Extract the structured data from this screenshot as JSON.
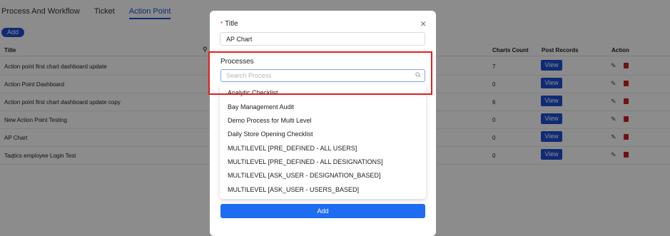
{
  "tabs": [
    "Process And Workflow",
    "Ticket",
    "Action Point"
  ],
  "toolbar": {
    "add_label": "Add"
  },
  "table": {
    "headers": {
      "title": "Title",
      "charts_count": "Charts Count",
      "post_records": "Post Records",
      "action": "Action"
    },
    "rows": [
      {
        "title": "Action point first chart dashboard update",
        "count": "7",
        "view": "View"
      },
      {
        "title": "Action Point Dashboard",
        "count": "0",
        "view": "View"
      },
      {
        "title": "Action point first chart dashboard update copy",
        "count": "6",
        "view": "View"
      },
      {
        "title": "New Action Point Testing",
        "count": "0",
        "view": "View"
      },
      {
        "title": "AP Chart",
        "count": "0",
        "view": "View"
      },
      {
        "title": "Taqtics employee Login Test",
        "count": "0",
        "view": "View"
      }
    ]
  },
  "modal": {
    "close": "×",
    "title_label": "Title",
    "required_mark": "*",
    "title_value": "AP Chart",
    "processes_label": "Processes",
    "search_placeholder": "Search Process",
    "options": [
      "Analytic Checklist",
      "Bay Management Audit",
      "Demo Process for Multi Level",
      "Daily Store Opening Checklist",
      "MULTILEVEL [PRE_DEFINED - ALL USERS]",
      "MULTILEVEL [PRE_DEFINED - ALL DESIGNATIONS]",
      "MULTILEVEL [ASK_USER - DESIGNATION_BASED]",
      "MULTILEVEL [ASK_USER - USERS_BASED]"
    ],
    "add_label": "Add"
  },
  "colors": {
    "primary": "#1e4fd6",
    "highlight": "#e01e1e",
    "delete": "#d42020"
  },
  "icons": {
    "search": "search-icon",
    "edit": "pencil-icon",
    "delete": "trash-icon",
    "close": "close-icon"
  }
}
